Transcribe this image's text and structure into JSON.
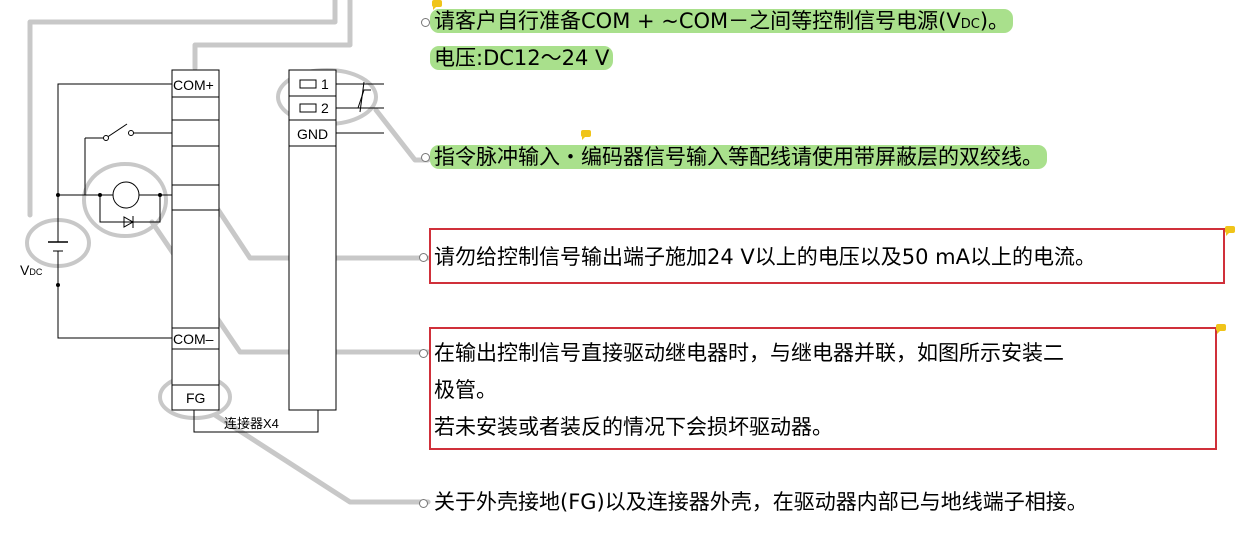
{
  "terminals": {
    "com_plus": "COM+",
    "com_minus": "COM–",
    "fg": "FG",
    "t1": "1",
    "t2": "2",
    "gnd": "GND",
    "connector": "连接器X4",
    "vdc_v": "V",
    "vdc_sub": "DC"
  },
  "notes": {
    "n1_pre": "请客户自行准备COM + ~COM－之间等控制信号电源(V",
    "n1_sub": "DC",
    "n1_post": ")。",
    "n1_line2": "电压:DC12～24 V",
    "n2": "指令脉冲输入・编码器信号输入等配线请使用带屏蔽层的双绞线。",
    "n3": "请勿给控制信号输出端子施加24 V以上的电压以及50 mA以上的电流。",
    "n4_l1": "在输出控制信号直接驱动继电器时，与继电器并联，如图所示安装二",
    "n4_l2": "极管。",
    "n4_l3": "若未安装或者装反的情况下会损坏驱动器。",
    "n5": "关于外壳接地(FG)以及连接器外壳，在驱动器内部已与地线端子相接。"
  },
  "colors": {
    "highlight": "#a9e08c",
    "warning_box": "#d0303a",
    "callout_line": "#c8c8c8",
    "comment_marker": "#f0c419"
  }
}
